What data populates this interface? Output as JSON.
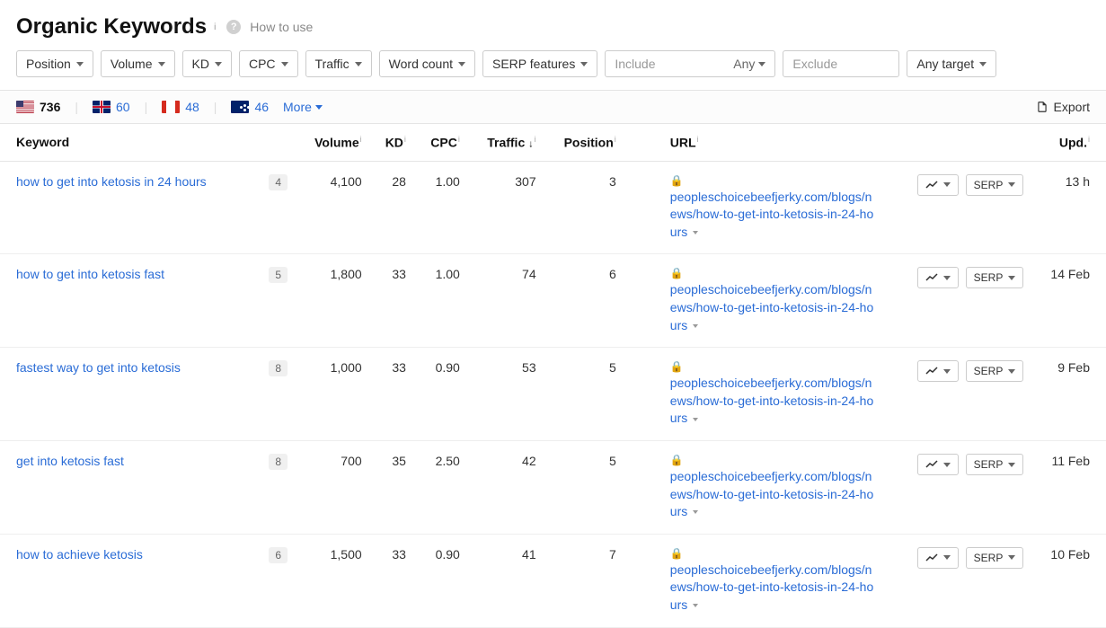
{
  "header": {
    "title": "Organic Keywords",
    "how_to_use": "How to use"
  },
  "filters": {
    "position": "Position",
    "volume": "Volume",
    "kd": "KD",
    "cpc": "CPC",
    "traffic": "Traffic",
    "word_count": "Word count",
    "serp_features": "SERP features",
    "include_placeholder": "Include",
    "include_mode": "Any",
    "exclude_placeholder": "Exclude",
    "target": "Any target"
  },
  "countries": {
    "us": "736",
    "gb": "60",
    "ca": "48",
    "au": "46",
    "more": "More"
  },
  "export_label": "Export",
  "columns": {
    "keyword": "Keyword",
    "volume": "Volume",
    "kd": "KD",
    "cpc": "CPC",
    "traffic": "Traffic",
    "position": "Position",
    "url": "URL",
    "upd": "Upd."
  },
  "serp_button": "SERP",
  "rows": [
    {
      "keyword": "how to get into ketosis in 24 hours",
      "kd_badge": "4",
      "volume": "4,100",
      "kd": "28",
      "cpc": "1.00",
      "traffic": "307",
      "position": "3",
      "url": "peopleschoicebeefjerky.com/blogs/news/how-to-get-into-ketosis-in-24-hours",
      "upd": "13 h"
    },
    {
      "keyword": "how to get into ketosis fast",
      "kd_badge": "5",
      "volume": "1,800",
      "kd": "33",
      "cpc": "1.00",
      "traffic": "74",
      "position": "6",
      "url": "peopleschoicebeefjerky.com/blogs/news/how-to-get-into-ketosis-in-24-hours",
      "upd": "14 Feb"
    },
    {
      "keyword": "fastest way to get into ketosis",
      "kd_badge": "8",
      "volume": "1,000",
      "kd": "33",
      "cpc": "0.90",
      "traffic": "53",
      "position": "5",
      "url": "peopleschoicebeefjerky.com/blogs/news/how-to-get-into-ketosis-in-24-hours",
      "upd": "9 Feb"
    },
    {
      "keyword": "get into ketosis fast",
      "kd_badge": "8",
      "volume": "700",
      "kd": "35",
      "cpc": "2.50",
      "traffic": "42",
      "position": "5",
      "url": "peopleschoicebeefjerky.com/blogs/news/how-to-get-into-ketosis-in-24-hours",
      "upd": "11 Feb"
    },
    {
      "keyword": "how to achieve ketosis",
      "kd_badge": "6",
      "volume": "1,500",
      "kd": "33",
      "cpc": "0.90",
      "traffic": "41",
      "position": "7",
      "url": "peopleschoicebeefjerky.com/blogs/news/how-to-get-into-ketosis-in-24-hours",
      "upd": "10 Feb"
    }
  ]
}
